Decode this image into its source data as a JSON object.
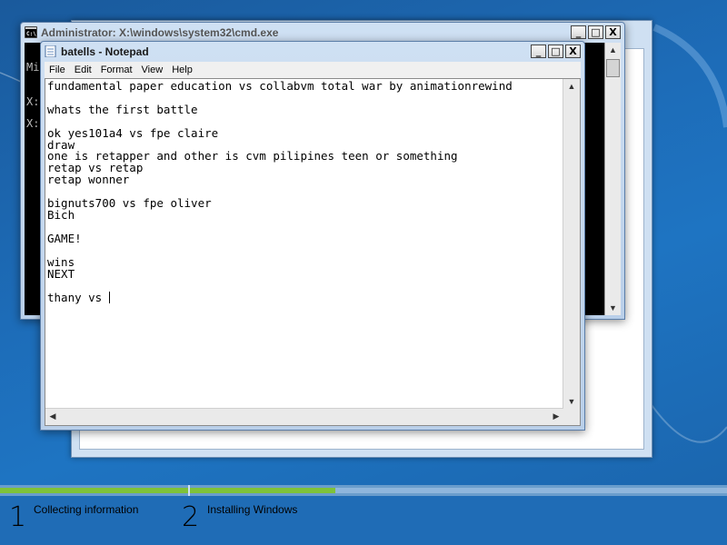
{
  "colors": {
    "desktop": "#1e6db8",
    "progress_fill": "#7ec23a"
  },
  "cmd": {
    "title": "Administrator: X:\\windows\\system32\\cmd.exe",
    "lines": [
      "Mi",
      "X:",
      "X:"
    ]
  },
  "notepad": {
    "title": "batells - Notepad",
    "menu": [
      "File",
      "Edit",
      "Format",
      "View",
      "Help"
    ],
    "lines": [
      "fundamental paper education vs collabvm total war by animationrewind",
      "",
      "whats the first battle",
      "",
      "ok yes101a4 vs fpe claire",
      "draw",
      "one is retapper and other is cvm pilipines teen or something",
      "retap vs retap",
      "retap wonner",
      "",
      "bignuts700 vs fpe oliver",
      "Bich",
      "",
      "GAME!",
      "",
      "wins",
      "NEXT",
      "",
      "thany vs "
    ]
  },
  "window_buttons": {
    "minimize": "_",
    "maximize": "□",
    "close": "X"
  },
  "setup": {
    "steps": [
      {
        "number": "1",
        "label": "Collecting information",
        "progress": 1.0
      },
      {
        "number": "2",
        "label": "Installing Windows",
        "progress": 0.27
      }
    ]
  }
}
